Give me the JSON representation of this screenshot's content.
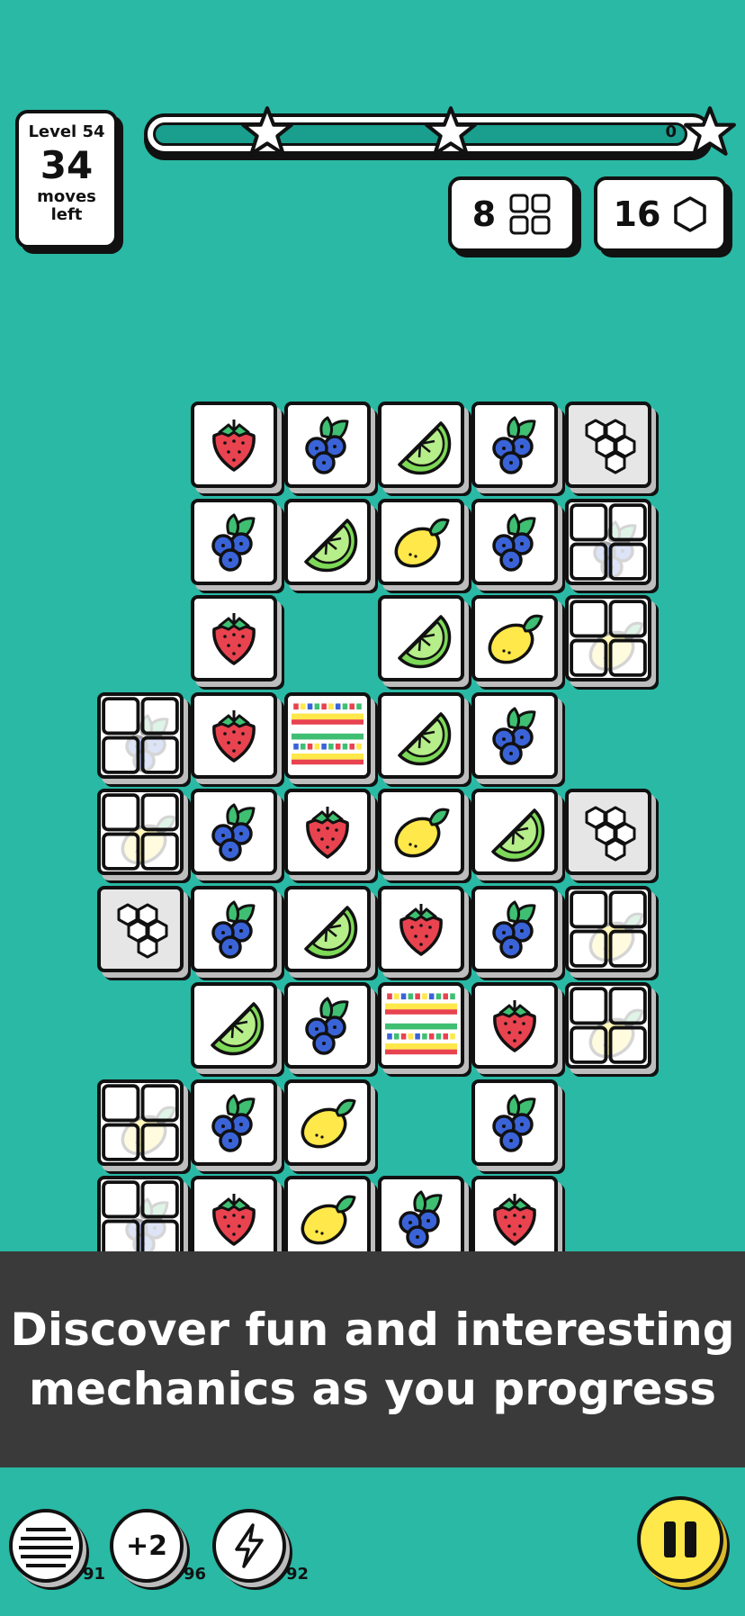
{
  "hud": {
    "level_label": "Level 54",
    "moves": "34",
    "moves_label_1": "moves",
    "moves_label_2": "left",
    "score": "0",
    "progress_fraction": 0.0,
    "stars": [
      "star",
      "star",
      "star"
    ]
  },
  "goals": [
    {
      "count": "8",
      "icon": "ice-grid-icon"
    },
    {
      "count": "16",
      "icon": "hexagon-icon"
    }
  ],
  "board": {
    "rows": [
      [
        "",
        "strawberry",
        "blueberry",
        "lime",
        "blueberry",
        "honeycomb"
      ],
      [
        "",
        "blueberry",
        "lime",
        "lemon",
        "blueberry",
        "ice-blueberry"
      ],
      [
        "",
        "strawberry",
        "",
        "lime",
        "lemon",
        "ice-lemon"
      ],
      [
        "ice-blueberry",
        "strawberry",
        "striped",
        "lime",
        "blueberry",
        ""
      ],
      [
        "ice-lemon",
        "blueberry",
        "strawberry",
        "lemon",
        "lime",
        "honeycomb"
      ],
      [
        "honeycomb",
        "blueberry",
        "lime",
        "strawberry",
        "blueberry",
        "ice-lemon"
      ],
      [
        "",
        "lime",
        "blueberry",
        "striped",
        "strawberry",
        "ice-lemon"
      ],
      [
        "ice-lemon",
        "blueberry",
        "lemon",
        "",
        "blueberry",
        ""
      ],
      [
        "ice-blueberry",
        "strawberry",
        "lemon",
        "blueberry",
        "strawberry",
        ""
      ]
    ]
  },
  "banner": {
    "line1": "Discover fun and interesting",
    "line2": "mechanics as you progress"
  },
  "boosters": [
    {
      "icon": "shuffle-lines-icon",
      "count": "91"
    },
    {
      "label": "+2",
      "count": "96"
    },
    {
      "icon": "lightning-icon",
      "count": "92"
    }
  ],
  "colors": {
    "background": "#29b9a5",
    "banner": "#3a3a3a",
    "pause": "#ffe84a"
  }
}
